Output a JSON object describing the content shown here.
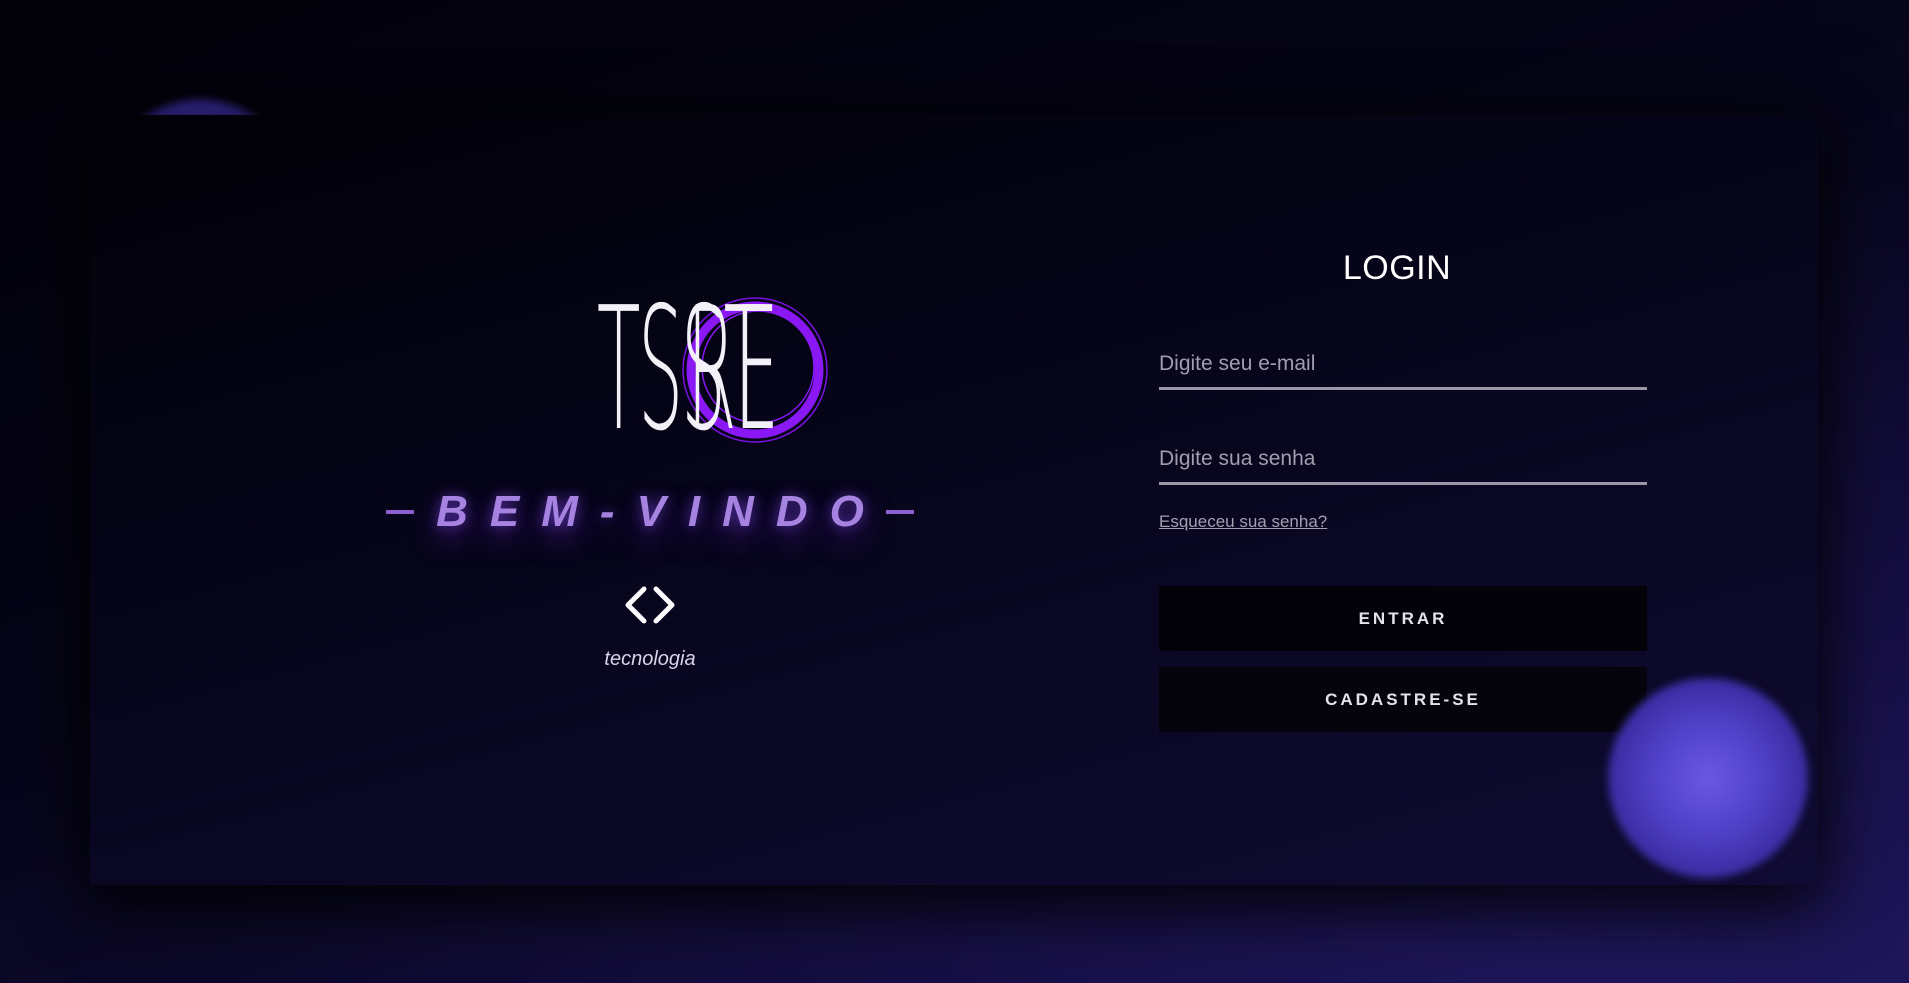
{
  "brand": {
    "logo_left": "TSST",
    "logo_right": "RE",
    "welcome": "BEM-VINDO",
    "tagline": "tecnologia",
    "logo_ring_color": "#8a18f5",
    "welcome_color": "#a683e0",
    "icon": "code-brackets-icon"
  },
  "login": {
    "title": "LOGIN",
    "email_placeholder": "Digite seu e-mail",
    "email_value": "",
    "password_placeholder": "Digite sua senha",
    "password_value": "",
    "forgot_link": "Esqueceu sua senha?",
    "enter_button": "ENTRAR",
    "signup_button": "CADASTRE-SE"
  },
  "theme": {
    "background": "#07061a",
    "orb_color": "#6a58e0",
    "button_bg": "#030208"
  }
}
